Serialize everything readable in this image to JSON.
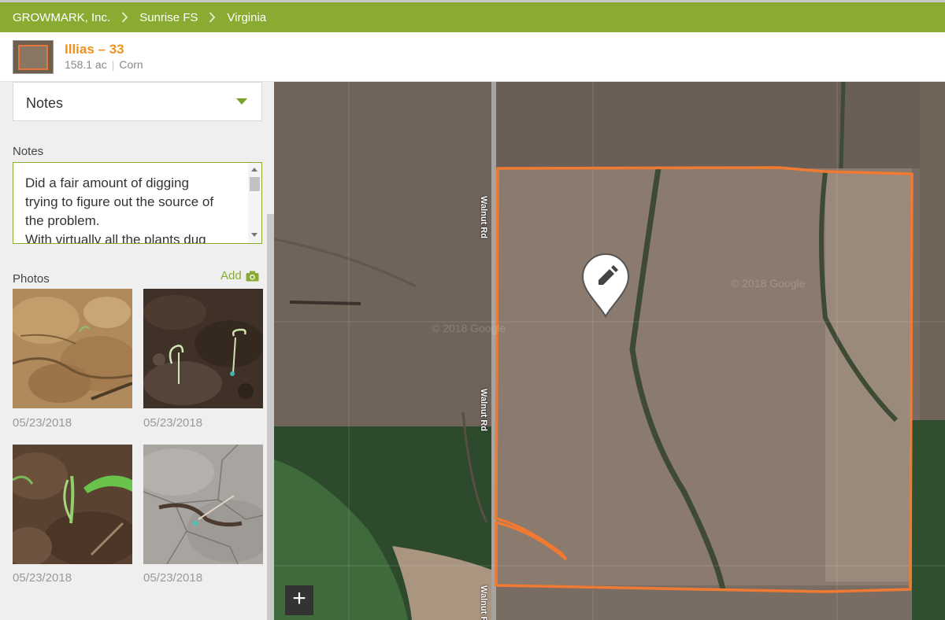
{
  "breadcrumb": [
    "GROWMARK, Inc.",
    "Sunrise FS",
    "Virginia"
  ],
  "field": {
    "name": "Illias – 33",
    "acres": "158.1 ac",
    "crop": "Corn"
  },
  "sidebar": {
    "view_select": "Notes",
    "notes_label": "Notes",
    "notes_text_lines": [
      "Did a fair amount of digging",
      "trying to figure out the source of",
      "the problem.",
      "With virtually all the plants dug"
    ],
    "photos_label": "Photos",
    "add_label": "Add",
    "photos": [
      {
        "date": "05/23/2018"
      },
      {
        "date": "05/23/2018"
      },
      {
        "date": "05/23/2018"
      },
      {
        "date": "05/23/2018"
      }
    ]
  },
  "map": {
    "road_label": "Walnut Rd",
    "watermark": "© 2018 Google",
    "zoom_in": "+",
    "boundary_color": "#f07a31"
  },
  "colors": {
    "brand_green": "#8aab31",
    "field_name": "#f0921e"
  }
}
